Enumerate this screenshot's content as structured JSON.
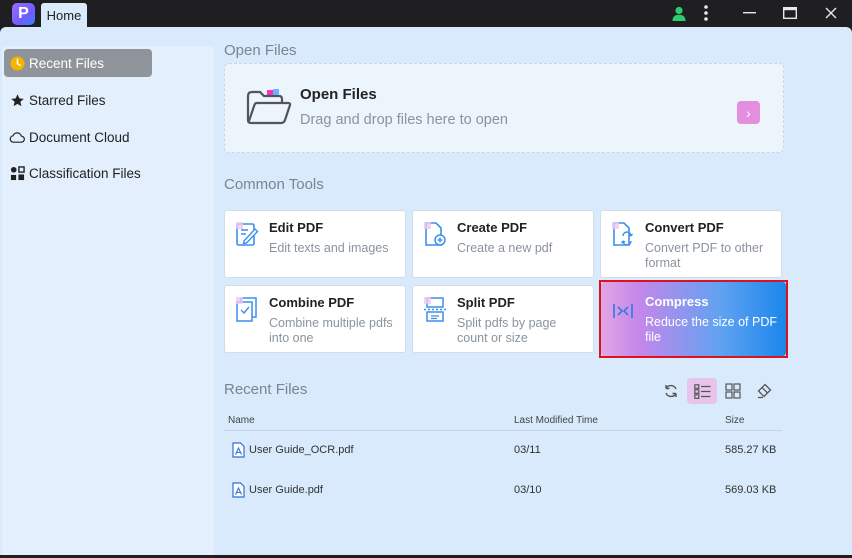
{
  "app": {
    "logo_letter": "P",
    "tab_label": "Home"
  },
  "window": {
    "minimize": "—",
    "maximize": "☐",
    "close": "✕"
  },
  "sidebar": {
    "items": [
      {
        "label": "Recent Files",
        "icon": "clock-icon",
        "active": true
      },
      {
        "label": "Starred Files",
        "icon": "star-icon",
        "active": false
      },
      {
        "label": "Document Cloud",
        "icon": "cloud-icon",
        "active": false
      },
      {
        "label": "Classification Files",
        "icon": "grid-icon",
        "active": false
      }
    ]
  },
  "open_files": {
    "section_title": "Open Files",
    "title": "Open Files",
    "subtitle": "Drag and drop files here to open",
    "arrow": "›"
  },
  "common_tools": {
    "section_title": "Common Tools",
    "tools": [
      {
        "title": "Edit PDF",
        "desc": "Edit texts and images",
        "icon": "edit-pdf-icon"
      },
      {
        "title": "Create PDF",
        "desc": "Create a new pdf",
        "icon": "create-pdf-icon"
      },
      {
        "title": "Convert PDF",
        "desc": "Convert PDF to other format",
        "icon": "convert-pdf-icon"
      },
      {
        "title": "Combine PDF",
        "desc": "Combine multiple pdfs into one",
        "icon": "combine-pdf-icon"
      },
      {
        "title": "Split PDF",
        "desc": "Split pdfs by page count or size",
        "icon": "split-pdf-icon"
      },
      {
        "title": "Compress",
        "desc": "Reduce the size of PDF file",
        "icon": "compress-icon",
        "highlighted": true
      }
    ]
  },
  "recent_files": {
    "section_title": "Recent Files",
    "columns": {
      "name": "Name",
      "modified": "Last Modified Time",
      "size": "Size"
    },
    "rows": [
      {
        "name": "User Guide_OCR.pdf",
        "modified": "03/11",
        "size": "585.27 KB"
      },
      {
        "name": "User Guide.pdf",
        "modified": "03/10",
        "size": "569.03 KB"
      }
    ],
    "view_mode": "list"
  },
  "colors": {
    "accent_pink": "#e48ee0",
    "highlight_border": "#d9141f",
    "background": "#d8eafb"
  }
}
